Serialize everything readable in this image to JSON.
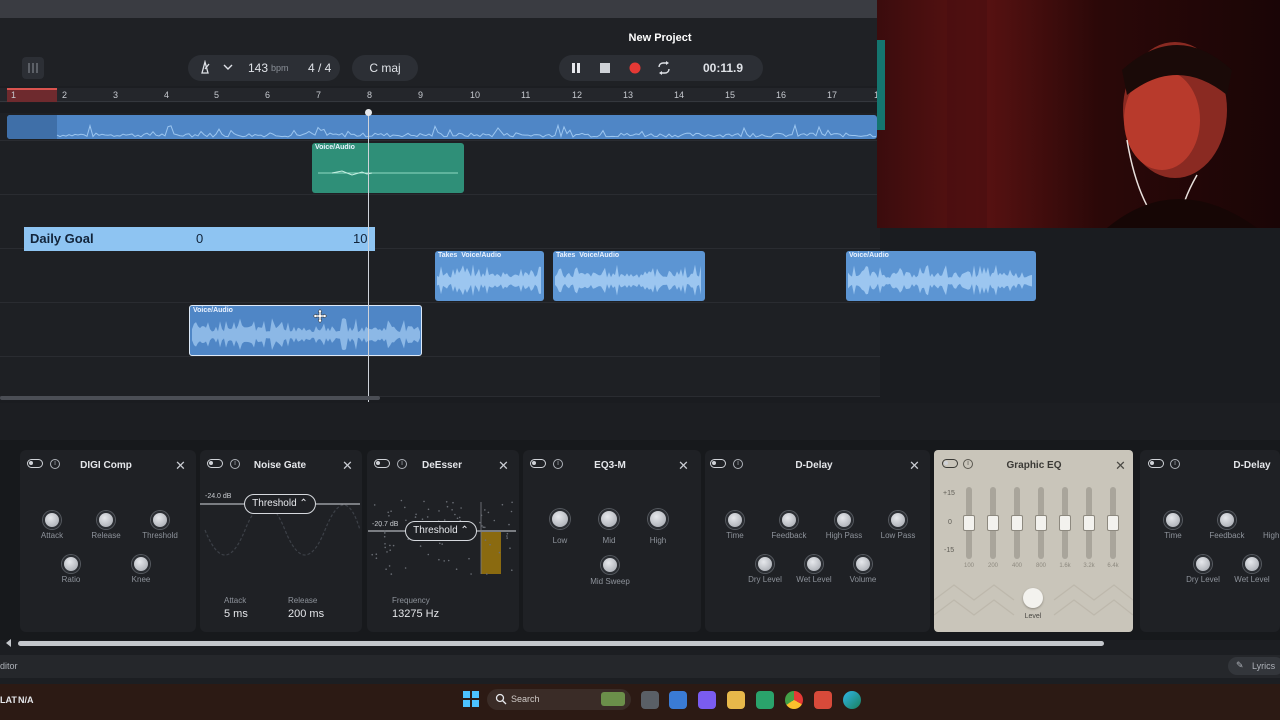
{
  "header": {
    "title": "New Project",
    "bpm_value": "143",
    "bpm_unit": "bpm",
    "time_signature": "4 / 4",
    "key": "C maj",
    "time_display": "00:11.9"
  },
  "ruler": {
    "bars": [
      "1",
      "2",
      "3",
      "4",
      "5",
      "6",
      "7",
      "8",
      "9",
      "10",
      "11",
      "12",
      "13",
      "14",
      "15",
      "16",
      "17",
      "1"
    ]
  },
  "clips": {
    "voice_audio": "Voice/Audio",
    "takes": "Takes"
  },
  "goal": {
    "label": "Daily Goal",
    "current": "0",
    "target": "10"
  },
  "effects": {
    "digi_comp": {
      "name": "DIGI Comp",
      "attack": "Attack",
      "release": "Release",
      "threshold": "Threshold",
      "ratio": "Ratio",
      "knee": "Knee"
    },
    "noise_gate": {
      "name": "Noise Gate",
      "db": "-24.0 dB",
      "threshold": "Threshold",
      "attack_label": "Attack",
      "attack_value": "5 ms",
      "release_label": "Release",
      "release_value": "200 ms"
    },
    "deesser": {
      "name": "DeEsser",
      "db": "-20.7 dB",
      "threshold": "Threshold",
      "frequency_label": "Frequency",
      "frequency_value": "13275 Hz"
    },
    "eq3m": {
      "name": "EQ3-M",
      "low": "Low",
      "mid": "Mid",
      "high": "High",
      "mid_sweep": "Mid Sweep"
    },
    "d_delay": {
      "name": "D-Delay",
      "time": "Time",
      "feedback": "Feedback",
      "high_pass": "High Pass",
      "low_pass": "Low Pass",
      "dry_level": "Dry Level",
      "wet_level": "Wet Level",
      "volume": "Volume"
    },
    "graphic_eq": {
      "name": "Graphic EQ",
      "scale": [
        "+15",
        "0",
        "-15"
      ],
      "bands": [
        "100",
        "200",
        "400",
        "800",
        "1.6k",
        "3.2k",
        "6.4k"
      ],
      "level": "Level"
    },
    "d_delay2": {
      "name": "D-Delay",
      "time": "Time",
      "feedback": "Feedback",
      "high": "High",
      "dry_level": "Dry Level",
      "wet_level": "Wet Level"
    }
  },
  "status": {
    "editor": "ditor",
    "lyrics": "Lyrics",
    "lat": "LAT",
    "na": "N/A"
  },
  "taskbar": {
    "search": "Search"
  },
  "colors": {
    "clip_blue": "#5c95d3",
    "clip_teal": "#2f8f78",
    "record_red": "#e53935",
    "goal_blue": "#8ec4f2"
  }
}
